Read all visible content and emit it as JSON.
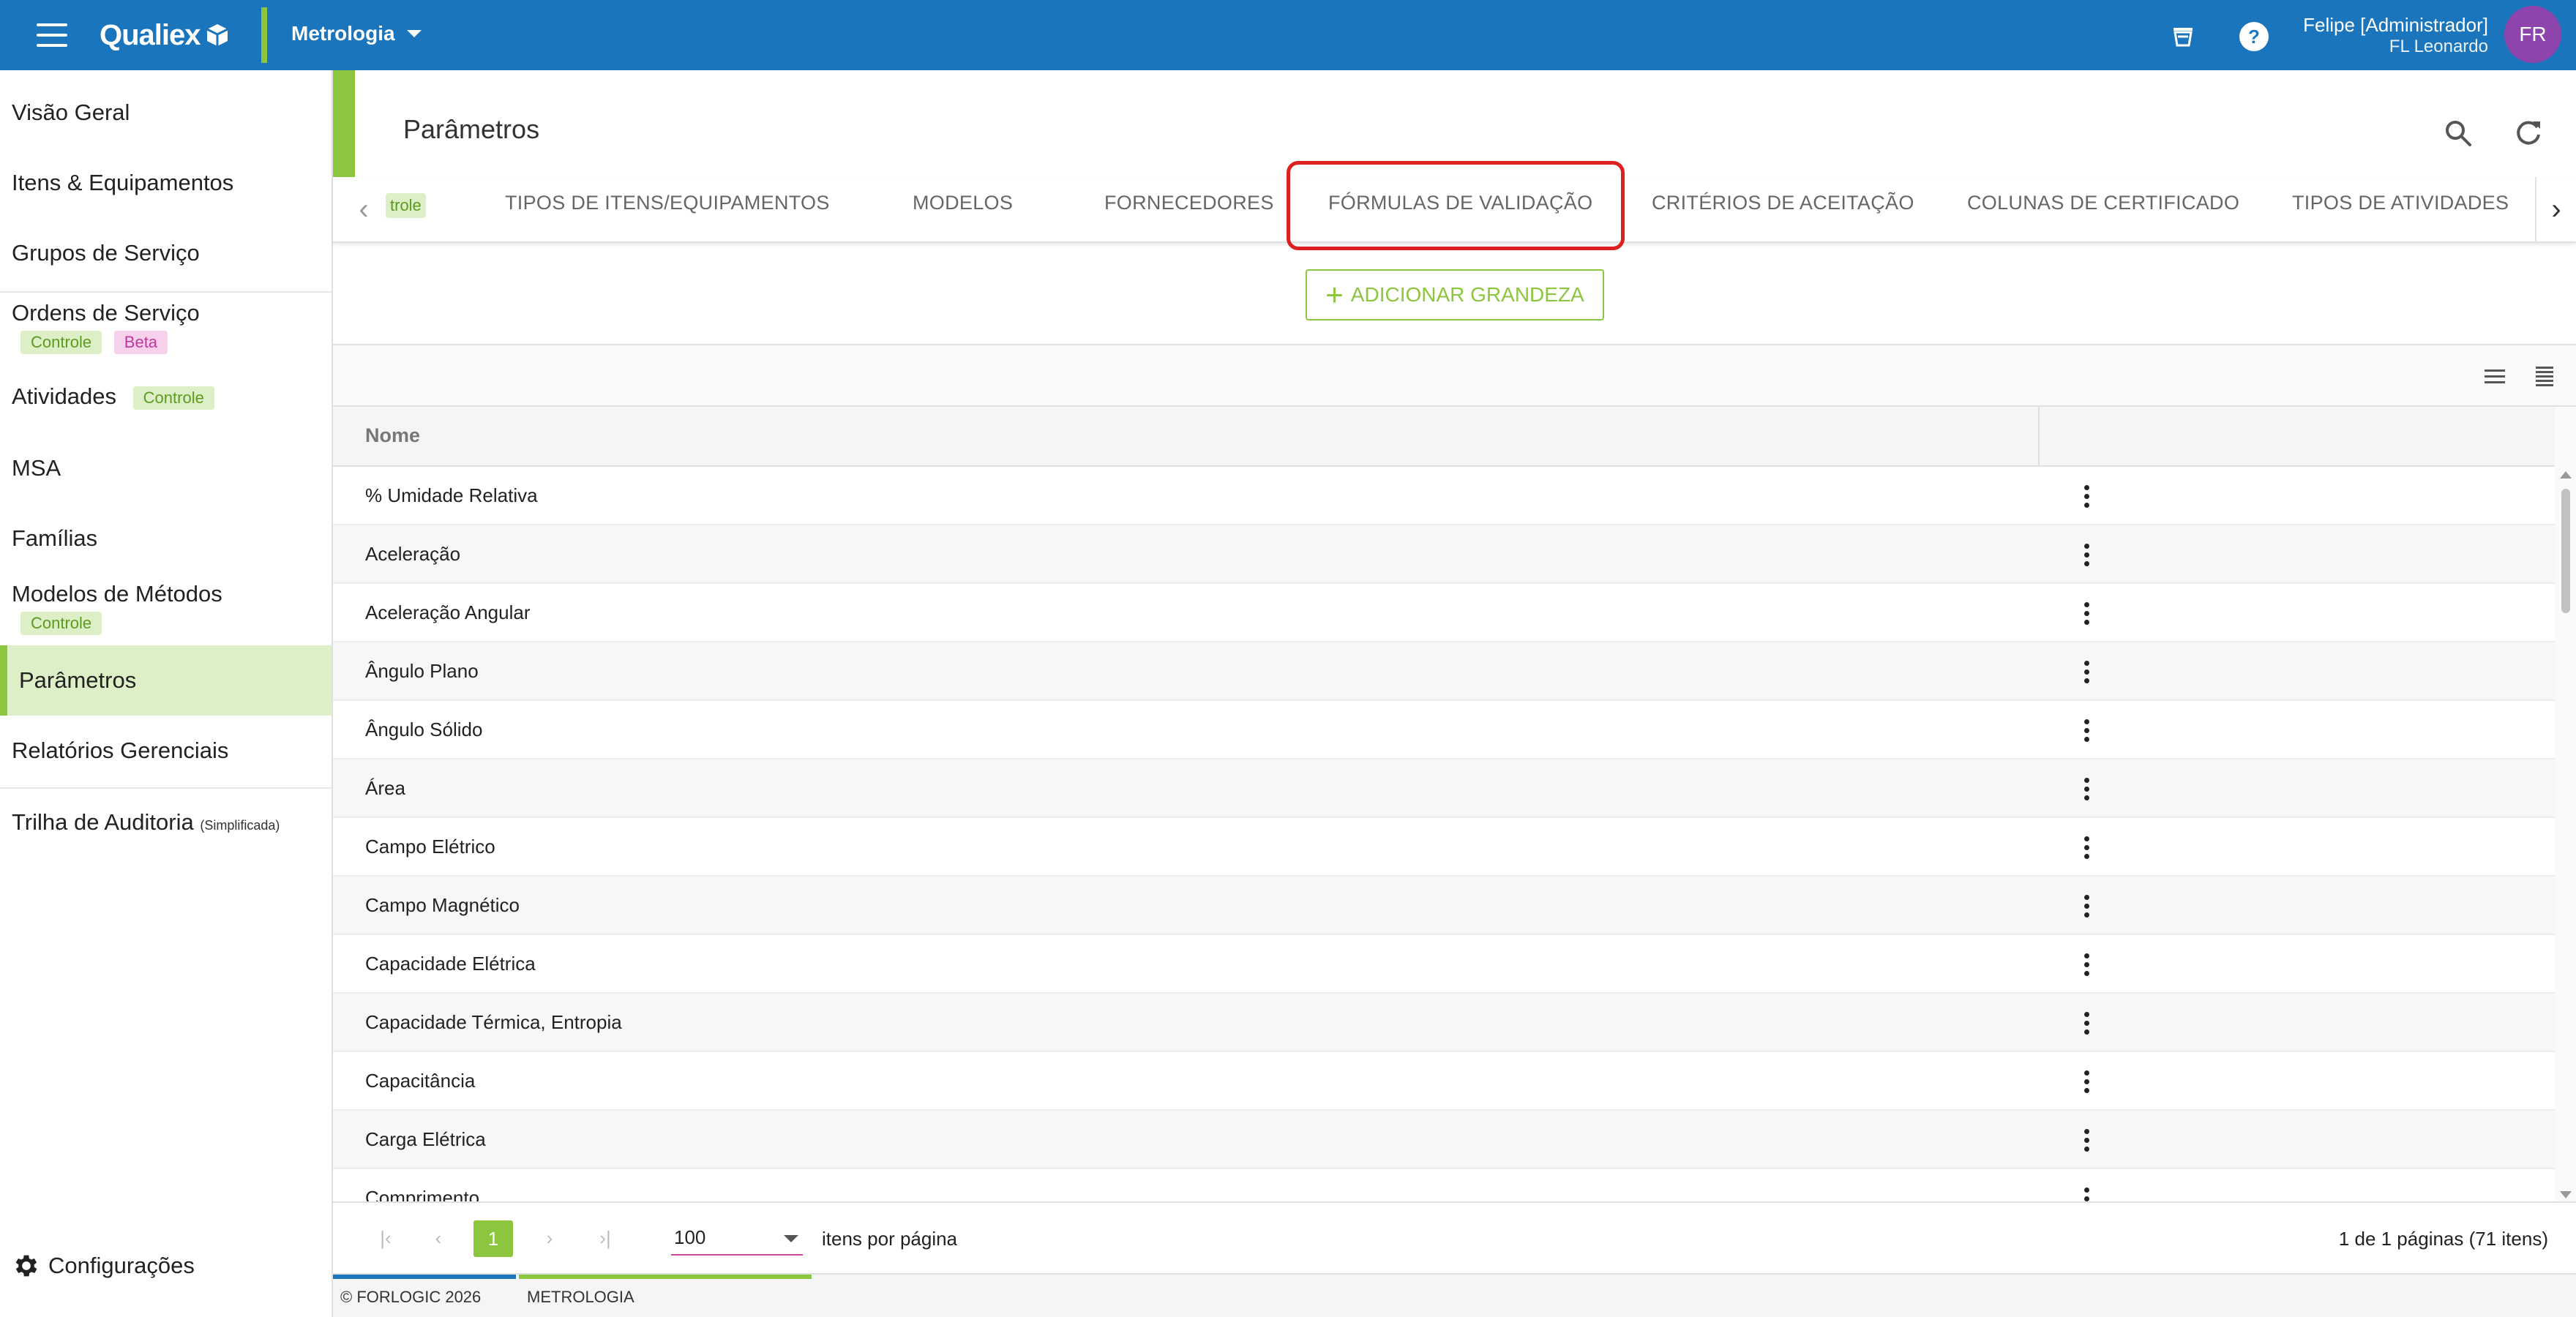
{
  "topbar": {
    "brand": "Qualiex",
    "module": "Metrologia",
    "user_name": "Felipe [Administrador]",
    "user_org": "FL Leonardo",
    "avatar_initials": "FR",
    "colors": {
      "primary": "#1b75bc",
      "accent": "#8cc63f",
      "avatar": "#8e44ad"
    }
  },
  "sidebar": {
    "items": [
      {
        "label": "Visão Geral"
      },
      {
        "label": "Itens & Equipamentos"
      },
      {
        "label": "Grupos de Serviço"
      },
      {
        "label": "Ordens de Serviço",
        "tags": [
          "Controle",
          "Beta"
        ]
      },
      {
        "label": "Atividades",
        "tags": [
          "Controle"
        ]
      },
      {
        "label": "MSA"
      },
      {
        "label": "Famílias"
      },
      {
        "label": "Modelos de Métodos",
        "tags": [
          "Controle"
        ]
      },
      {
        "label": "Parâmetros",
        "active": true
      },
      {
        "label": "Relatórios Gerenciais"
      },
      {
        "label": "Trilha de Auditoria",
        "sub": "(Simplificada)"
      }
    ],
    "settings_label": "Configurações"
  },
  "page": {
    "title": "Parâmetros",
    "tabs": [
      {
        "label": "trole"
      },
      {
        "label": "TIPOS DE ITENS/EQUIPAMENTOS"
      },
      {
        "label": "MODELOS"
      },
      {
        "label": "FORNECEDORES"
      },
      {
        "label": "FÓRMULAS DE VALIDAÇÃO"
      },
      {
        "label": "CRITÉRIOS DE ACEITAÇÃO"
      },
      {
        "label": "COLUNAS DE CERTIFICADO"
      },
      {
        "label": "TIPOS DE ATIVIDADES"
      }
    ],
    "add_button": "ADICIONAR GRANDEZA"
  },
  "grid": {
    "column_name": "Nome",
    "rows": [
      "% Umidade Relativa",
      "Aceleração",
      "Aceleração Angular",
      "Ângulo Plano",
      "Ângulo Sólido",
      "Área",
      "Campo Elétrico",
      "Campo Magnético",
      "Capacidade Elétrica",
      "Capacidade Térmica, Entropia",
      "Capacitância",
      "Carga Elétrica",
      "Comprimento"
    ]
  },
  "pager": {
    "current_page": "1",
    "page_size": "100",
    "page_size_label": "itens por página",
    "info": "1 de 1 páginas (71 itens)"
  },
  "footer": {
    "copyright": "© FORLOGIC 2026",
    "module": "METROLOGIA"
  }
}
